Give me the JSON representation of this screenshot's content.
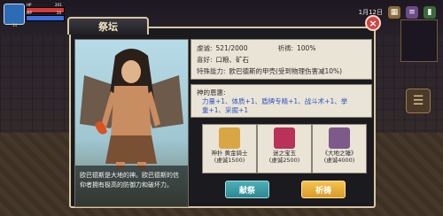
{
  "hud": {
    "hp_label": "HP",
    "hp_value": "201",
    "mp_label": "MP",
    "mp_value": "20",
    "level": "14",
    "colors": {
      "hp": "#d33a3a",
      "mp": "#3d6fe0",
      "exp": "#e0c040"
    }
  },
  "topbar": {
    "date": "1月12日"
  },
  "dialog": {
    "title": "祭坛",
    "close_symbol": "×",
    "stats": {
      "piety_label": "虔诚:",
      "piety_value": "521/2000",
      "prayer_label": "祈祷:",
      "prayer_value": "100%",
      "likes_label": "喜好:",
      "likes_value": "口粮、矿石",
      "special_label": "特殊能力:",
      "special_value": "欧巴德斯的甲壳(受到物理伤害减10%)"
    },
    "blessing": {
      "title": "神的恩惠:",
      "line1": "力量+1、体质+1、盾牌专精+1、战斗术+1、挙",
      "line2": "重+1、采掘+1"
    },
    "caption": "欧巴德斯是大地的神。欧巴德斯的信仰者拥有极高的防御力和破坏力。",
    "offerings": [
      {
        "name": "神扑 黄金骑士",
        "cost": "(虔诚1500)",
        "icon": "gold-knight-icon",
        "color": "#d8a642"
      },
      {
        "name": "迷之宝玉",
        "cost": "(虔诚2500)",
        "icon": "red-gem-icon",
        "color": "#b8325a"
      },
      {
        "name": "《大地之锤》",
        "cost": "(虔诚4000)",
        "icon": "earth-hammer-icon",
        "color": "#7d5a8a"
      }
    ],
    "buttons": {
      "sacrifice": "献祭",
      "pray": "祈祷"
    }
  }
}
